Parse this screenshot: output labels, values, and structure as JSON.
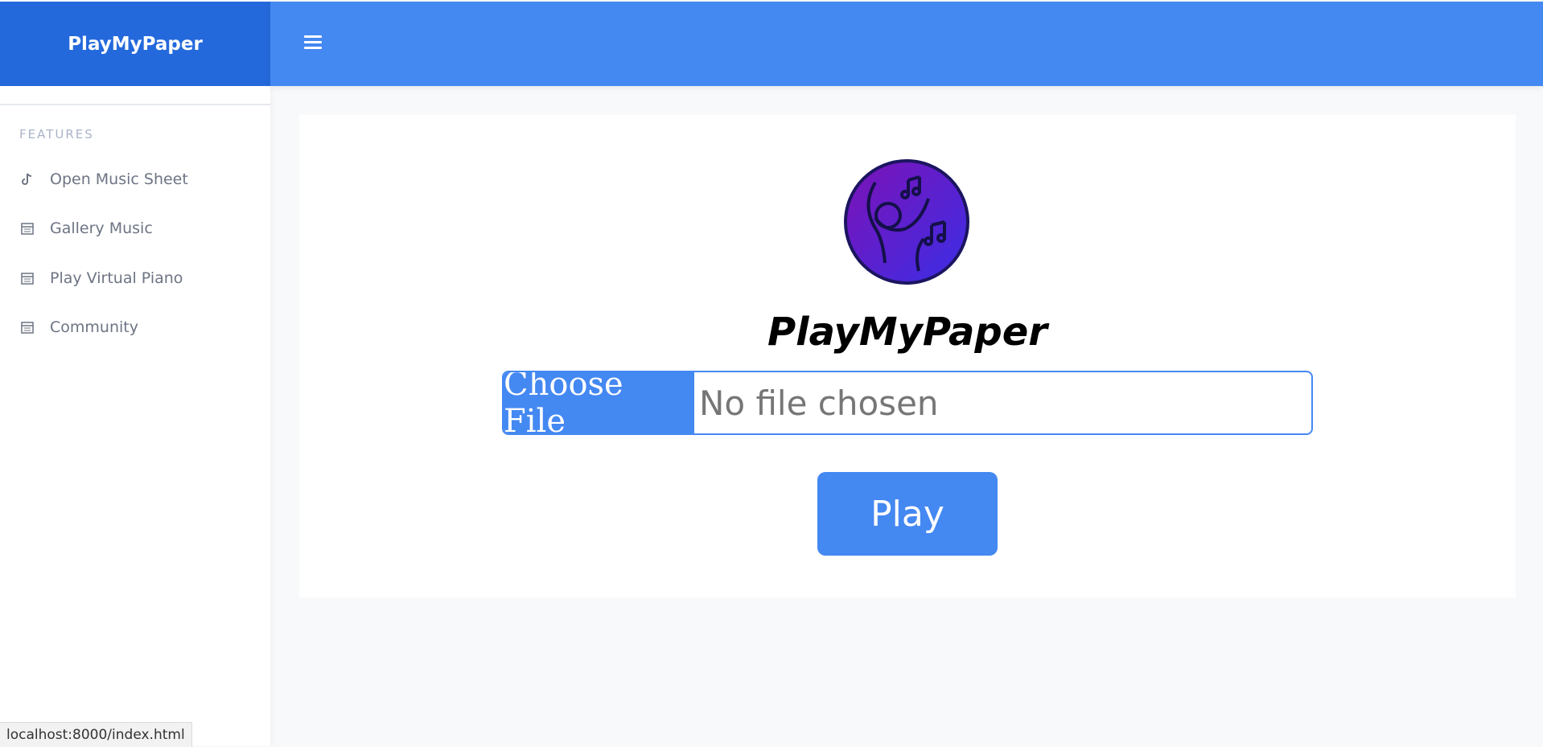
{
  "app": {
    "brand": "PlayMyPaper",
    "brand_color": "#2469dc",
    "topbar_color": "#4488f2"
  },
  "sidebar": {
    "heading": "FEATURES",
    "items": [
      {
        "label": "Open Music Sheet",
        "icon": "tiktok-note-icon"
      },
      {
        "label": "Gallery Music",
        "icon": "calendar-icon"
      },
      {
        "label": "Play Virtual Piano",
        "icon": "calendar-icon"
      },
      {
        "label": "Community",
        "icon": "calendar-icon"
      }
    ]
  },
  "topbar": {
    "menu_icon": "hamburger-icon"
  },
  "main": {
    "logo_icon": "dancing-music-logo-icon",
    "logo_text": "PlayMyPaper",
    "file_input": {
      "button_label": "Choose File",
      "status": "No file chosen"
    },
    "play_label": "Play"
  },
  "statusbar": {
    "url": "localhost:8000/index.html"
  }
}
